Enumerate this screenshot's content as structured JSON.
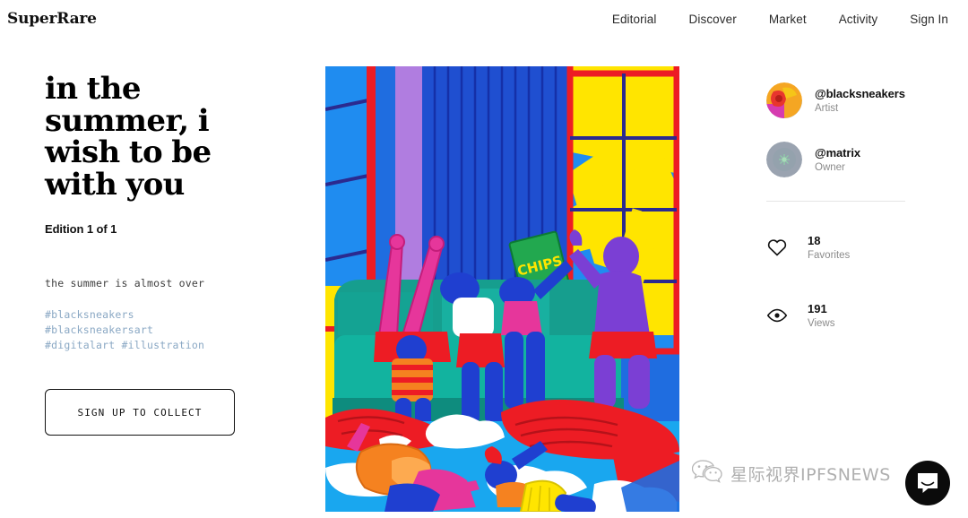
{
  "header": {
    "logo": "SuperRare",
    "nav": [
      {
        "label": "Editorial",
        "name": "nav-editorial"
      },
      {
        "label": "Discover",
        "name": "nav-discover"
      },
      {
        "label": "Market",
        "name": "nav-market"
      },
      {
        "label": "Activity",
        "name": "nav-activity"
      },
      {
        "label": "Sign In",
        "name": "nav-sign-in"
      }
    ]
  },
  "artwork": {
    "title": "in the summer, i wish to be with you",
    "edition": "Edition 1 of 1",
    "description": "the summer is almost over",
    "tags": [
      "#blacksneakers",
      "#blacksneakersart",
      "#digitalart #illustration"
    ],
    "collect_button": "SIGN UP TO COLLECT",
    "image_alt": "Colorful flat illustration of figures lounging on a teal sofa in a room with blue curtains, red-framed windows and yellow sunlight, with a CHIPS bag and a dreamlike sky of red swirls and clouds below",
    "palette": {
      "blue": "#1f6de0",
      "sky_blue": "#19a7ef",
      "red": "#ed1c24",
      "yellow": "#ffe500",
      "teal": "#169e8e",
      "magenta": "#e6369b",
      "purple": "#7b3fd4",
      "lilac": "#b07de0",
      "orange": "#f58220",
      "green": "#22a84f",
      "white": "#ffffff"
    },
    "chips_label": "CHIPS"
  },
  "people": [
    {
      "handle": "@blacksneakers",
      "role": "Artist",
      "avatar": "artist-avatar"
    },
    {
      "handle": "@matrix",
      "role": "Owner",
      "avatar": "owner-avatar"
    }
  ],
  "stats": [
    {
      "icon": "heart-icon",
      "value": "18",
      "label": "Favorites"
    },
    {
      "icon": "eye-icon",
      "value": "191",
      "label": "Views"
    }
  ],
  "watermark": {
    "text": "星际视界IPFSNEWS",
    "icon": "wechat-icon"
  },
  "chat_widget": {
    "icon": "chat-bubble-icon"
  }
}
